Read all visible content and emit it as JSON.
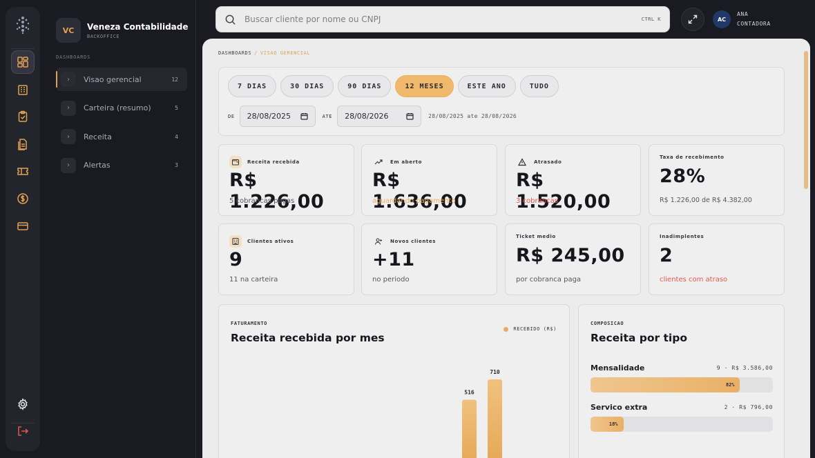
{
  "org": {
    "initials": "VC",
    "name": "Veneza Contabilidade",
    "subtitle": "BACKOFFICE"
  },
  "sidebar": {
    "section": "DASHBOARDS",
    "items": [
      {
        "label": "Visao gerencial",
        "count": "12"
      },
      {
        "label": "Carteira (resumo)",
        "count": "5"
      },
      {
        "label": "Receita",
        "count": "4"
      },
      {
        "label": "Alertas",
        "count": "3"
      }
    ]
  },
  "rail_icons": [
    "dashboard-icon",
    "building-icon",
    "clipboard-icon",
    "documents-icon",
    "ticket-icon",
    "dollar-icon",
    "card-icon",
    "gear-icon",
    "logout-icon"
  ],
  "search": {
    "placeholder": "Buscar cliente por nome ou CNPJ",
    "shortcut": "CTRL K"
  },
  "user": {
    "initials": "AC",
    "line1": "ANA",
    "line2": "CONTADORA"
  },
  "breadcrumb": {
    "root": "DASHBOARDS",
    "sep": "/",
    "current": "VISAO GERENCIAL"
  },
  "filters": {
    "periods": [
      "7 DIAS",
      "30 DIAS",
      "90 DIAS",
      "12 MESES",
      "ESTE ANO",
      "TUDO"
    ],
    "active_period": "12 MESES",
    "from_label": "DE",
    "from_value": "28/08/2025",
    "to_label": "ATE",
    "to_value": "28/08/2026",
    "range_text": "28/08/2025 ate 28/08/2026"
  },
  "kpis": [
    {
      "label": "Receita recebida",
      "value": "R$ 1.226,00",
      "sub": "5 cobrancas pagas",
      "icon": "wallet-icon"
    },
    {
      "label": "Em aberto",
      "value": "R$ 1.636,00",
      "sub": "aguardando pagamento",
      "icon": "trend-up-icon"
    },
    {
      "label": "Atrasado",
      "value": "R$ 1.520,00",
      "sub": "3 cobrancas",
      "icon": "warning-icon"
    },
    {
      "label": "Taxa de recebimento",
      "value": "28%",
      "sub": "R$ 1.226,00 de R$ 4.382,00"
    },
    {
      "label": "Clientes ativos",
      "value": "9",
      "sub": "11 na carteira",
      "icon": "building-icon"
    },
    {
      "label": "Novos clientes",
      "value": "+11",
      "sub": "no periodo",
      "icon": "user-plus-icon"
    },
    {
      "label": "Ticket medio",
      "value": "R$ 245,00",
      "sub": "por cobranca paga"
    },
    {
      "label": "Inadimplentes",
      "value": "2",
      "sub": "clientes com atraso"
    }
  ],
  "revenue_panel": {
    "kicker": "FATURAMENTO",
    "title": "Receita recebida por mes",
    "legend": "RECEBIDO (R$)"
  },
  "chart_data": {
    "type": "bar",
    "series": [
      {
        "name": "RECEBIDO (R$)",
        "values": [
          516,
          710
        ]
      }
    ],
    "data_labels": [
      "516",
      "710"
    ],
    "color": "#e8ad62"
  },
  "composition": {
    "kicker": "COMPOSICAO",
    "title": "Receita por tipo",
    "items": [
      {
        "name": "Mensalidade",
        "value": "9 · R$ 3.586,00",
        "percent": "82%",
        "fraction": 0.82
      },
      {
        "name": "Servico extra",
        "value": "2 · R$ 796,00",
        "percent": "18%",
        "fraction": 0.18
      }
    ]
  },
  "colors": {
    "accent": "#e3a24e",
    "danger": "#e6574d",
    "warning": "#ecae60"
  }
}
